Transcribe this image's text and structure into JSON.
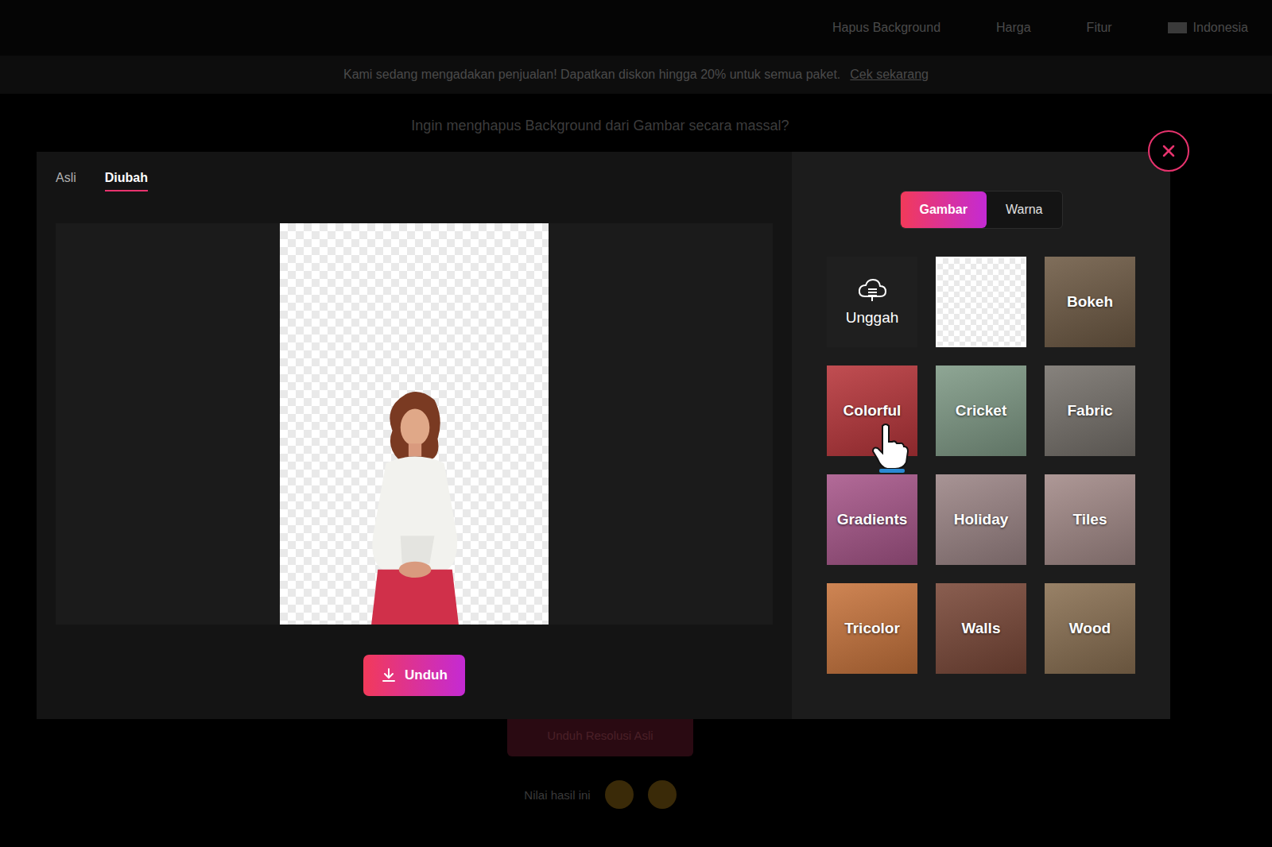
{
  "nav": {
    "items": [
      "Hapus Background",
      "Harga",
      "Fitur"
    ],
    "language": "Indonesia"
  },
  "banner": {
    "text": "Kami sedang mengadakan penjualan! Dapatkan diskon hingga 20% untuk semua paket.",
    "link": "Cek sekarang"
  },
  "page": {
    "headline": "Ingin menghapus Background dari Gambar secara massal?",
    "download_hd": "Unduh Resolusi Asli",
    "rate_label": "Nilai hasil ini"
  },
  "modal": {
    "view_tabs": [
      {
        "label": "Asli",
        "selected": false
      },
      {
        "label": "Diubah",
        "selected": true
      }
    ],
    "download": "Unduh",
    "bg_tabs": [
      {
        "label": "Gambar",
        "selected": true
      },
      {
        "label": "Warna",
        "selected": false
      }
    ],
    "backgrounds": [
      {
        "label": "Unggah",
        "kind": "upload",
        "color": "#1f1f1f",
        "pointer": false
      },
      {
        "label": "",
        "kind": "transparent",
        "color": "#ffffff",
        "pointer": false
      },
      {
        "label": "Bokeh",
        "kind": "texture",
        "color": "#6e5a44",
        "pointer": false
      },
      {
        "label": "Colorful",
        "kind": "texture",
        "color": "#b8353a",
        "pointer": true
      },
      {
        "label": "Cricket",
        "kind": "texture",
        "color": "#7f9a86",
        "pointer": false
      },
      {
        "label": "Fabric",
        "kind": "texture",
        "color": "#76716b",
        "pointer": false
      },
      {
        "label": "Gradients",
        "kind": "texture",
        "color": "#a8568a",
        "pointer": false
      },
      {
        "label": "Holiday",
        "kind": "texture",
        "color": "#9c8586",
        "pointer": false
      },
      {
        "label": "Tiles",
        "kind": "texture",
        "color": "#a38a88",
        "pointer": false
      },
      {
        "label": "Tricolor",
        "kind": "texture",
        "color": "#c8743c",
        "pointer": false
      },
      {
        "label": "Walls",
        "kind": "texture",
        "color": "#7a4838",
        "pointer": false
      },
      {
        "label": "Wood",
        "kind": "texture",
        "color": "#8a7052",
        "pointer": false
      }
    ]
  }
}
